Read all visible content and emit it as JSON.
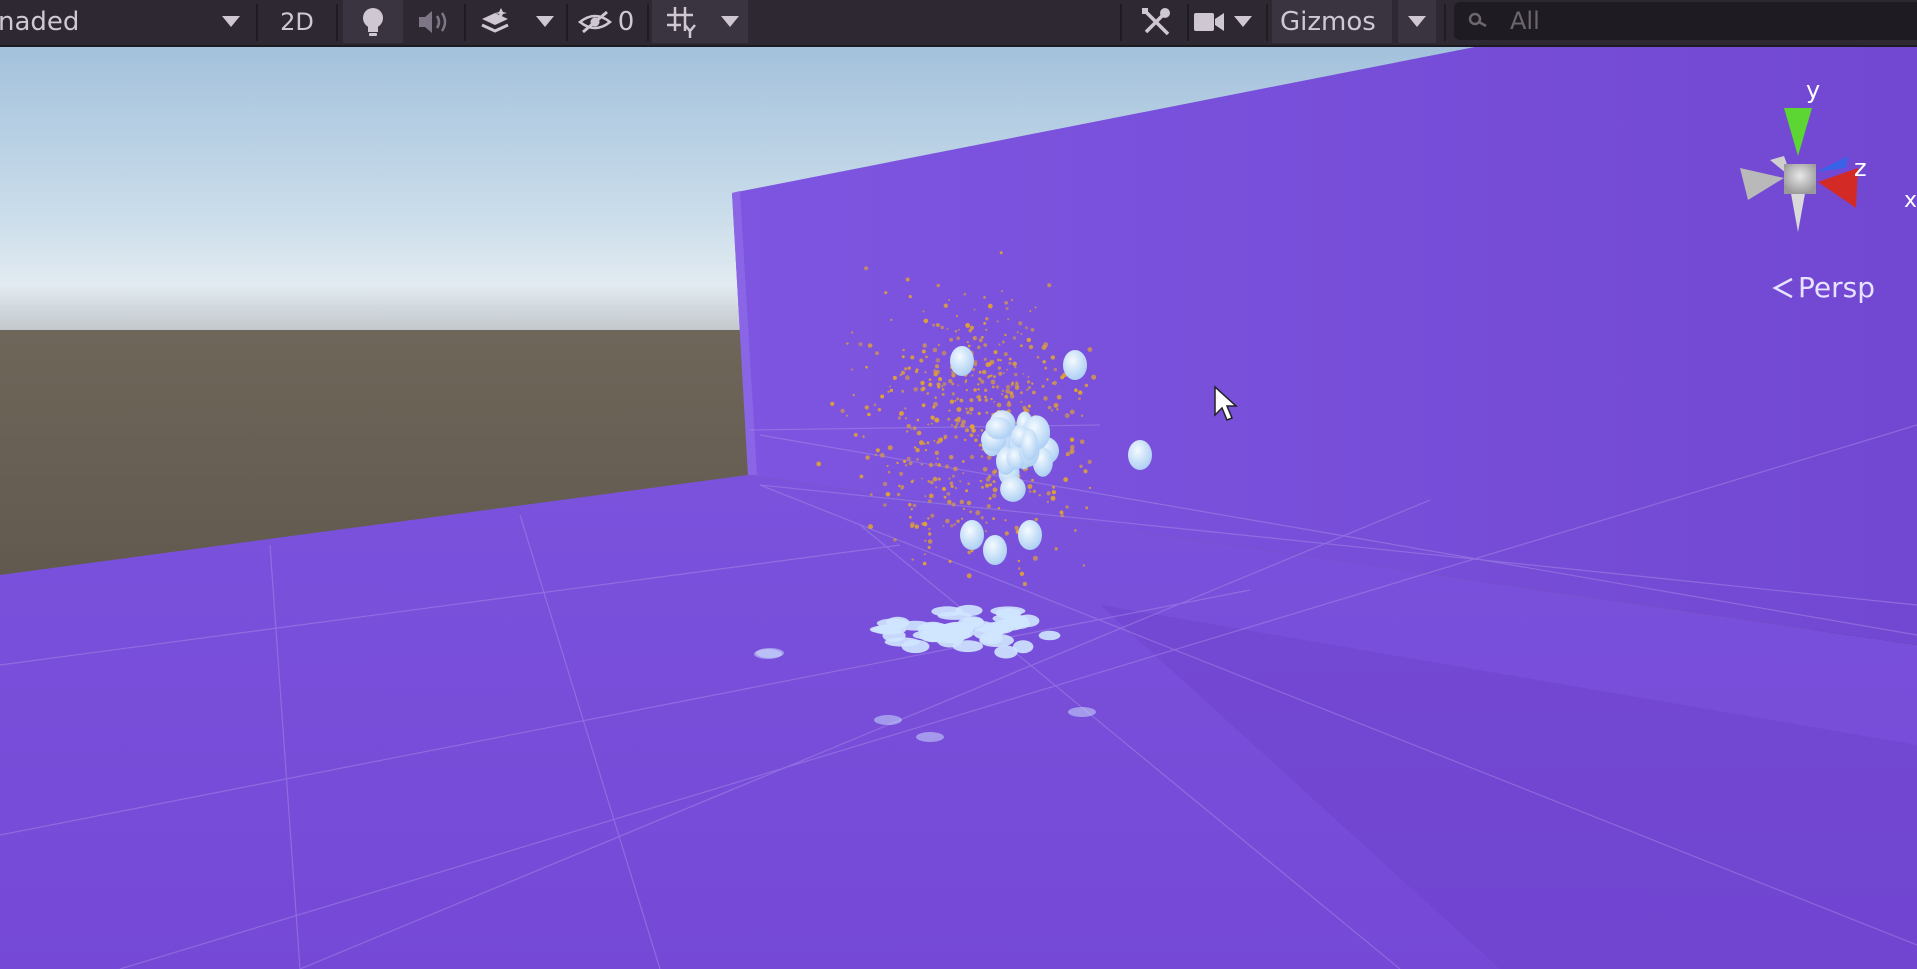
{
  "toolbar": {
    "draw_mode": "naded",
    "toggle_2d": "2D",
    "hidden_count": "0",
    "gizmos": "Gizmos",
    "search_placeholder": "All",
    "icons": [
      "chevron-down-icon",
      "lightbulb-icon",
      "audio-icon",
      "effects-icon",
      "hidden-objects-icon",
      "grid-icon",
      "tools-icon",
      "camera-icon",
      "search-icon"
    ]
  },
  "viewport": {
    "projection": "Persp",
    "axis_labels": {
      "y": "y",
      "z": "z",
      "x": "x"
    },
    "colors": {
      "surface": "#7449d8",
      "sky_top": "#a8c6e0",
      "ground": "#6e6356",
      "axis_y": "#5cd632",
      "axis_z": "#3a62e8",
      "axis_x": "#d42a26",
      "particles_water": "#cfe6ff",
      "particles_spark": "#e0a235"
    }
  }
}
